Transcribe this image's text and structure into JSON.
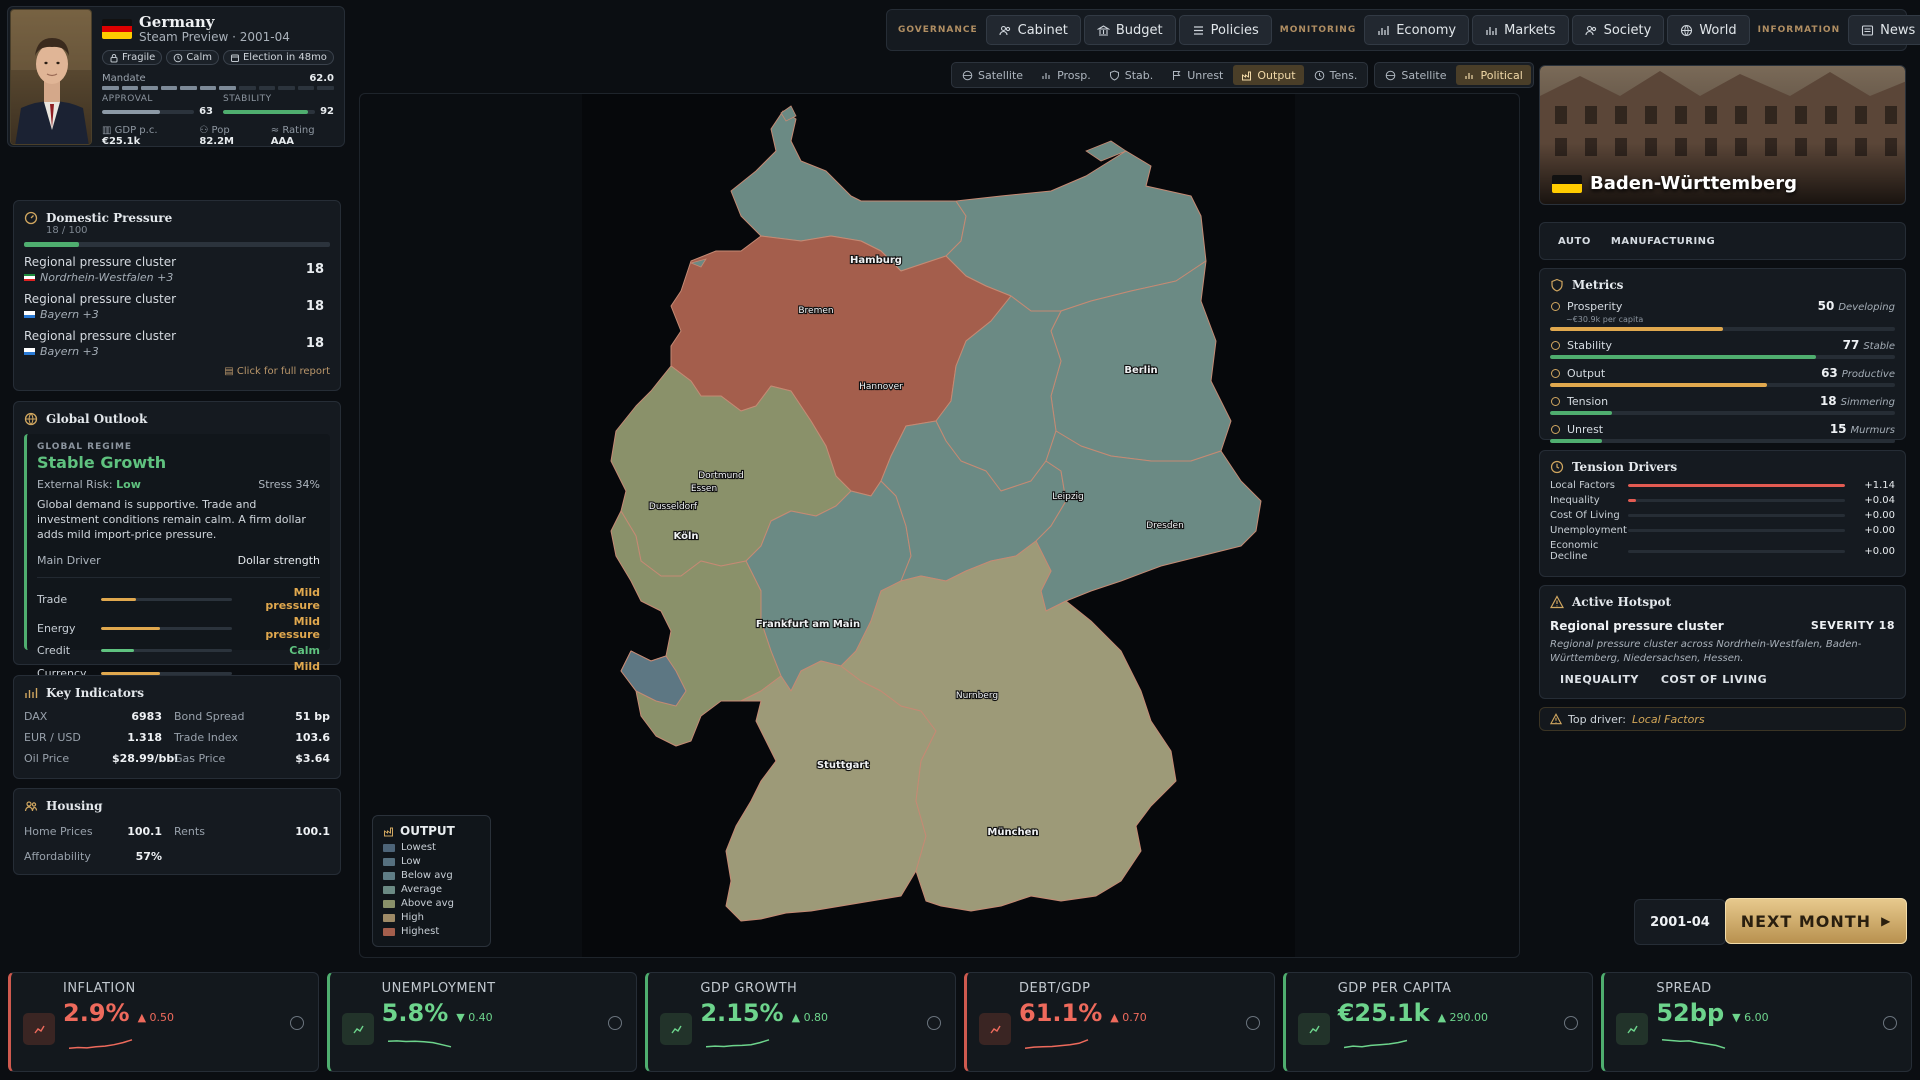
{
  "profile": {
    "country": "Germany",
    "subtitle": "Steam Preview · 2001-04",
    "chips": [
      "Fragile",
      "Calm",
      "Election in 48mo"
    ],
    "mandate_label": "Mandate",
    "mandate_value": "62.0",
    "mandate_level": 0.62,
    "approval_label": "APPROVAL",
    "approval_value": "63",
    "approval_level": 0.63,
    "stability_label": "STABILITY",
    "stability_value": "92",
    "stability_level": 0.92,
    "gdp_label": "GDP p.c.",
    "gdp_value": "€25.1k",
    "pop_label": "Pop",
    "pop_value": "82.2M",
    "rating_label": "Rating",
    "rating_value": "AAA"
  },
  "domestic": {
    "title": "Domestic Pressure",
    "sub": "18 / 100",
    "level": 0.18,
    "clusters": [
      {
        "name": "Regional pressure cluster",
        "loc": "Nordrhein-Westfalen +3",
        "value": "18"
      },
      {
        "name": "Regional pressure cluster",
        "loc": "Bayern +3",
        "value": "18"
      },
      {
        "name": "Regional pressure cluster",
        "loc": "Bayern +3",
        "value": "18"
      }
    ],
    "report_link": "Click for full report"
  },
  "outlook": {
    "title": "Global Outlook",
    "regime_label": "GLOBAL REGIME",
    "regime_name": "Stable Growth",
    "risk_label": "External Risk:",
    "risk_value": "Low",
    "stress": "Stress 34%",
    "description": "Global demand is supportive. Trade and investment conditions remain calm. A firm dollar adds mild import-price pressure.",
    "driver_label": "Main Driver",
    "driver_value": "Dollar strength",
    "factors": [
      {
        "name": "Trade",
        "level": 0.27,
        "color": "#e0a84e",
        "label": "Mild pressure"
      },
      {
        "name": "Energy",
        "level": 0.45,
        "color": "#e0a84e",
        "label": "Mild pressure"
      },
      {
        "name": "Credit",
        "level": 0.25,
        "color": "#5fc27f",
        "label": "Calm"
      },
      {
        "name": "Currency",
        "level": 0.45,
        "color": "#e0a84e",
        "label": "Mild pressure"
      }
    ]
  },
  "indicators": {
    "title": "Key Indicators",
    "rows": [
      {
        "k1": "DAX",
        "v1": "6983",
        "k2": "Bond Spread",
        "v2": "51 bp"
      },
      {
        "k1": "EUR / USD",
        "v1": "1.318",
        "k2": "Trade Index",
        "v2": "103.6"
      },
      {
        "k1": "Oil Price",
        "v1": "$28.99/bbl",
        "k2": "Gas Price",
        "v2": "$3.64"
      }
    ]
  },
  "housing": {
    "title": "Housing",
    "home_label": "Home Prices",
    "home_value": "100.1",
    "rents_label": "Rents",
    "rents_value": "100.1",
    "afford_label": "Affordability",
    "afford_value": "57%"
  },
  "nav": {
    "governance": "GOVERNANCE",
    "cabinet": "Cabinet",
    "budget": "Budget",
    "policies": "Policies",
    "monitoring": "MONITORING",
    "economy": "Economy",
    "markets": "Markets",
    "society": "Society",
    "world": "World",
    "information": "INFORMATION",
    "news": "News"
  },
  "modes": {
    "satellite": "Satellite",
    "prosp": "Prosp.",
    "stab": "Stab.",
    "unrest": "Unrest",
    "output": "Output",
    "tens": "Tens.",
    "satellite2": "Satellite",
    "political": "Political"
  },
  "map": {
    "cities": [
      "Hamburg",
      "Bremen",
      "Hannover",
      "Berlin",
      "Dortmund",
      "Essen",
      "Dusseldorf",
      "Köln",
      "Leipzig",
      "Dresden",
      "Frankfurt am Main",
      "Nurnberg",
      "Stuttgart",
      "München"
    ],
    "colors": {
      "teal": "#6b8a84",
      "red": "#a45e4c",
      "olive": "#8a916a",
      "tan": "#9d9a78",
      "blue": "#5d7783"
    }
  },
  "legend": {
    "title": "OUTPUT",
    "items": [
      {
        "label": "Lowest",
        "color": "#4d6478"
      },
      {
        "label": "Low",
        "color": "#56707f"
      },
      {
        "label": "Below avg",
        "color": "#5f7d86"
      },
      {
        "label": "Average",
        "color": "#6b8a84"
      },
      {
        "label": "Above avg",
        "color": "#8a916a"
      },
      {
        "label": "High",
        "color": "#9e8a66"
      },
      {
        "label": "Highest",
        "color": "#a45e4c"
      }
    ]
  },
  "region": {
    "name": "Baden-Württemberg",
    "tags": [
      "AUTO",
      "MANUFACTURING"
    ]
  },
  "metrics": {
    "title": "Metrics",
    "items": [
      {
        "name": "Prosperity",
        "value": "50",
        "status": "Developing",
        "level": 0.5,
        "color": "#e0a84e",
        "note": "~€30.9k per capita"
      },
      {
        "name": "Stability",
        "value": "77",
        "status": "Stable",
        "level": 0.77,
        "color": "#4fae6f"
      },
      {
        "name": "Output",
        "value": "63",
        "status": "Productive",
        "level": 0.63,
        "color": "#e0a84e"
      },
      {
        "name": "Tension",
        "value": "18",
        "status": "Simmering",
        "level": 0.18,
        "color": "#4fae6f"
      },
      {
        "name": "Unrest",
        "value": "15",
        "status": "Murmurs",
        "level": 0.15,
        "color": "#4fae6f"
      }
    ]
  },
  "drivers": {
    "title": "Tension Drivers",
    "items": [
      {
        "name": "Local Factors",
        "value": "+1.14",
        "level": 1.0
      },
      {
        "name": "Inequality",
        "value": "+0.04",
        "level": 0.035
      },
      {
        "name": "Cost Of Living",
        "value": "+0.00",
        "level": 0
      },
      {
        "name": "Unemployment",
        "value": "+0.00",
        "level": 0
      },
      {
        "name": "Economic Decline",
        "value": "+0.00",
        "level": 0
      }
    ]
  },
  "hotspot": {
    "title": "Active Hotspot",
    "name": "Regional pressure cluster",
    "severity": "SEVERITY 18",
    "description": "Regional pressure cluster across Nordrhein-Westfalen, Baden-Württemberg, Niedersachsen, Hessen.",
    "tags": [
      "INEQUALITY",
      "COST OF LIVING"
    ]
  },
  "top_driver": {
    "label": "Top driver:",
    "value": "Local Factors"
  },
  "date": "2001-04",
  "next_label": "NEXT MONTH",
  "kpis": [
    {
      "label": "INFLATION",
      "value": "2.9%",
      "delta": "▲ 0.50",
      "tone": "bad"
    },
    {
      "label": "UNEMPLOYMENT",
      "value": "5.8%",
      "delta": "▼ 0.40",
      "tone": "good"
    },
    {
      "label": "GDP GROWTH",
      "value": "2.15%",
      "delta": "▲ 0.80",
      "tone": "good"
    },
    {
      "label": "DEBT/GDP",
      "value": "61.1%",
      "delta": "▲ 0.70",
      "tone": "bad"
    },
    {
      "label": "GDP PER CAPITA",
      "value": "€25.1k",
      "delta": "▲ 290.00",
      "tone": "good"
    },
    {
      "label": "SPREAD",
      "value": "52bp",
      "delta": "▼ 6.00",
      "tone": "good"
    }
  ]
}
